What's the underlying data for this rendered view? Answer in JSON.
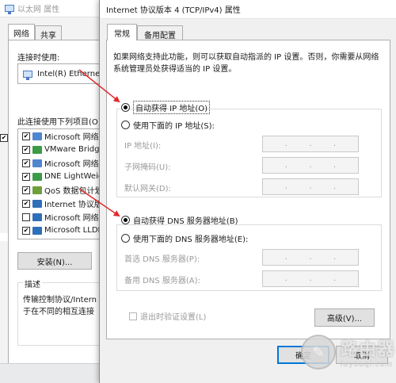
{
  "background_window": {
    "title": "以太网 属性",
    "tabs": [
      "网络",
      "共享"
    ],
    "connect_using_label": "连接时使用:",
    "adapter_name": "Intel(R) Ethernet",
    "components_label": "此连接使用下列项目(O):",
    "components": [
      {
        "label": "Microsoft 网络",
        "checked": true,
        "icon": "network-client-icon"
      },
      {
        "label": "VMware Bridg",
        "checked": true,
        "icon": "network-service-icon"
      },
      {
        "label": "Microsoft 网络",
        "checked": true,
        "icon": "network-client-icon"
      },
      {
        "label": "DNE LightWeig",
        "checked": true,
        "icon": "network-service-icon"
      },
      {
        "label": "QoS 数据包计划",
        "checked": true,
        "icon": "qos-icon"
      },
      {
        "label": "Internet 协议版",
        "checked": true,
        "icon": "protocol-icon"
      },
      {
        "label": "Microsoft 网络",
        "checked": false,
        "icon": "protocol-icon"
      },
      {
        "label": "Microsoft LLDP",
        "checked": true,
        "icon": "protocol-icon"
      }
    ],
    "install_button": "安装(N)...",
    "description_legend": "描述",
    "description_lines": [
      "传输控制协议/Intern",
      "于在不同的相互连接"
    ]
  },
  "dialog": {
    "title": "Internet 协议版本 4 (TCP/IPv4) 属性",
    "tabs": [
      "常规",
      "备用配置"
    ],
    "description": "如果网络支持此功能，则可以获取自动指派的 IP 设置。否则，你需要从网络系统管理员处获得适当的 IP 设置。",
    "ip_auto_label": "自动获得 IP 地址(O)",
    "ip_manual_label": "使用下面的 IP 地址(S):",
    "ip_address_label": "IP 地址(I):",
    "subnet_mask_label": "子网掩码(U):",
    "gateway_label": "默认网关(D):",
    "dns_auto_label": "自动获得 DNS 服务器地址(B)",
    "dns_manual_label": "使用下面的 DNS 服务器地址(E):",
    "preferred_dns_label": "首选 DNS 服务器(P):",
    "alternate_dns_label": "备用 DNS 服务器(A):",
    "validate_on_exit_label": "退出时验证设置(L)",
    "advanced_button": "高级(V)...",
    "ok_button": "确定",
    "cancel_button": "取消",
    "ip_auto_selected": true,
    "dns_auto_selected": true,
    "ip_dot": "."
  },
  "watermark": {
    "text_cn": "路由器",
    "text_en": "luyouqi.com"
  },
  "colors": {
    "arrow": "#e0282a",
    "focus": "#0078d7"
  }
}
